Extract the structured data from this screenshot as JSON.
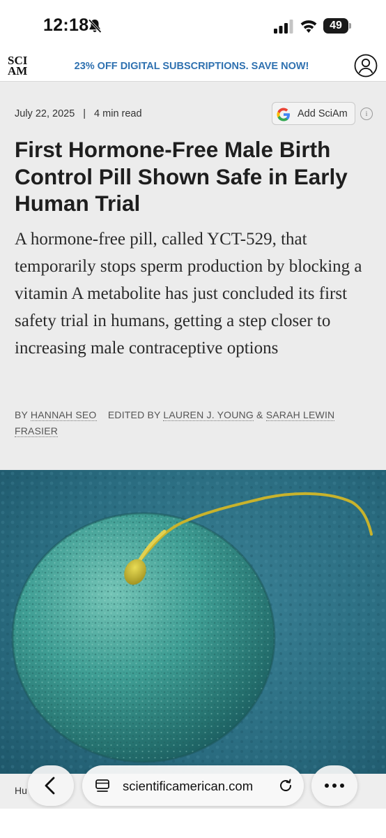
{
  "status_bar": {
    "time": "12:18",
    "battery": "49"
  },
  "header": {
    "logo": "SCI AM",
    "logo_line1": "SCI",
    "logo_line2": "AM",
    "promo": "23% OFF DIGITAL SUBSCRIPTIONS. SAVE NOW!"
  },
  "article": {
    "date": "July 22, 2025",
    "separator": "|",
    "read_time": "4 min read",
    "add_button_label": "Add SciAm",
    "info_label": "i",
    "headline": "First Hormone-Free Male Birth Control Pill Shown Safe in Early Human Trial",
    "dek": "A hormone-free pill, called YCT-529, that temporarily stops sperm production by blocking a vitamin A metabolite has just concluded its first safety trial in humans, getting a step closer to increasing male contraceptive options",
    "byline": {
      "by": "BY",
      "author": "HANNAH SEO",
      "edited_by": "EDITED BY",
      "editor1": "LAUREN J. YOUNG",
      "amp": "&",
      "editor2": "SARAH LEWIN FRASIER"
    }
  },
  "hero": {
    "caption": "Hu"
  },
  "browser_bar": {
    "url": "scientificamerican.com"
  },
  "colors": {
    "promo": "#2f71b0",
    "article_bg": "#ececec",
    "hero_bg": "#2a6c80",
    "egg": "#3a9e94",
    "sperm": "#c8b32c"
  },
  "icons": [
    "bell-slash-icon",
    "signal-icon",
    "wifi-icon",
    "battery-icon",
    "account-icon",
    "google-icon",
    "info-icon",
    "chevron-left-icon",
    "tabs-icon",
    "reload-icon",
    "more-icon"
  ]
}
